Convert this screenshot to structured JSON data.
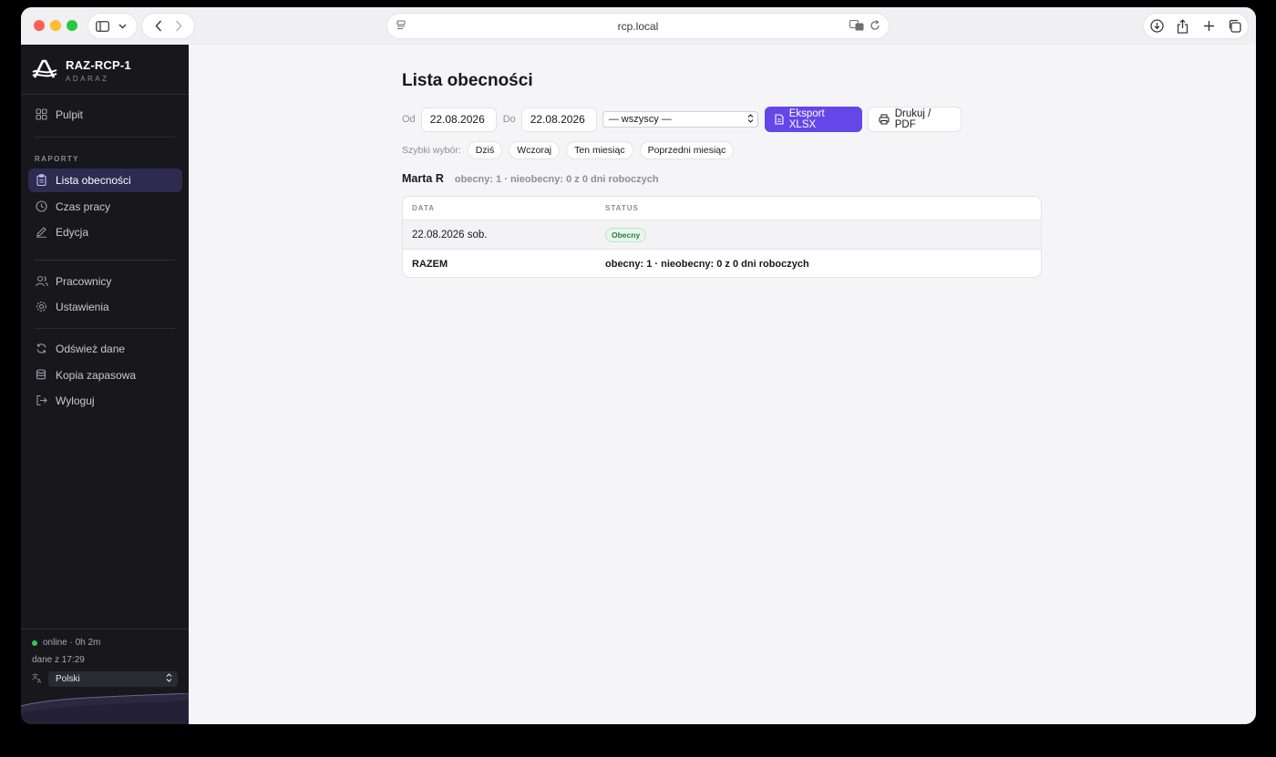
{
  "browser": {
    "address": "rcp.local"
  },
  "sidebar": {
    "brand_name": "RAZ-RCP-1",
    "brand_sub": "ADARAZ",
    "items": [
      {
        "label": "Pulpit",
        "icon": "grid-icon"
      },
      {
        "label": "Lista obecności",
        "icon": "clipboard-icon"
      },
      {
        "label": "Czas pracy",
        "icon": "clock-icon"
      },
      {
        "label": "Edycja",
        "icon": "pencil-icon"
      },
      {
        "label": "Pracownicy",
        "icon": "users-icon"
      },
      {
        "label": "Ustawienia",
        "icon": "gear-icon"
      },
      {
        "label": "Odśwież dane",
        "icon": "refresh-icon"
      },
      {
        "label": "Kopia zapasowa",
        "icon": "database-icon"
      },
      {
        "label": "Wyloguj",
        "icon": "logout-icon"
      }
    ],
    "section_reports": "RAPORTY",
    "status_online": "online · 0h 2m",
    "status_data": "dane z 17:29",
    "language": "Polski",
    "colors": {
      "bg": "#17171c",
      "active": "#2f2a4f"
    }
  },
  "main": {
    "title": "Lista obecności",
    "filters": {
      "from_label": "Od",
      "from_value": "22.08.2026",
      "to_label": "Do",
      "to_value": "22.08.2026",
      "employee": "— wszyscy —",
      "export_label": "Eksport XLSX",
      "print_label": "Drukuj / PDF"
    },
    "quick": {
      "label": "Szybki wybór:",
      "options": [
        "Dziś",
        "Wczoraj",
        "Ten miesiąc",
        "Poprzedni miesiąc"
      ]
    },
    "employee_summary": {
      "name": "Marta R",
      "summary": "obecny: 1 · nieobecny: 0 z 0 dni roboczych"
    },
    "table": {
      "headers": [
        "DATA",
        "STATUS"
      ],
      "rows": [
        {
          "date": "22.08.2026 sob.",
          "status": "Obecny"
        }
      ],
      "footer": {
        "label": "RAZEM",
        "value": "obecny: 1 · nieobecny: 0 z 0 dni roboczych"
      }
    },
    "colors": {
      "accent": "#6447e8",
      "present": "#21813b"
    }
  }
}
